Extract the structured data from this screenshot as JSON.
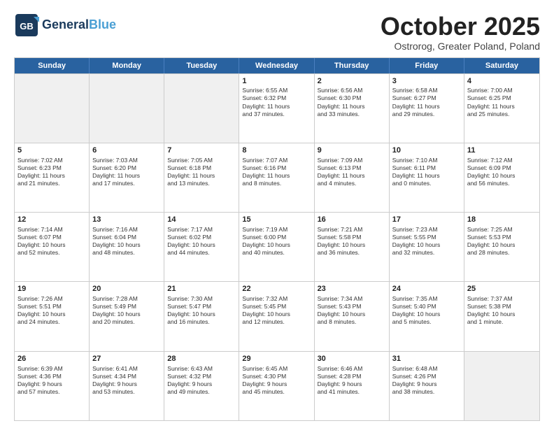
{
  "logo": {
    "line1": "General",
    "line2": "Blue",
    "tagline": ""
  },
  "header": {
    "month": "October 2025",
    "location": "Ostrorog, Greater Poland, Poland"
  },
  "days": [
    "Sunday",
    "Monday",
    "Tuesday",
    "Wednesday",
    "Thursday",
    "Friday",
    "Saturday"
  ],
  "rows": [
    [
      {
        "day": "",
        "content": ""
      },
      {
        "day": "",
        "content": ""
      },
      {
        "day": "",
        "content": ""
      },
      {
        "day": "1",
        "content": "Sunrise: 6:55 AM\nSunset: 6:32 PM\nDaylight: 11 hours\nand 37 minutes."
      },
      {
        "day": "2",
        "content": "Sunrise: 6:56 AM\nSunset: 6:30 PM\nDaylight: 11 hours\nand 33 minutes."
      },
      {
        "day": "3",
        "content": "Sunrise: 6:58 AM\nSunset: 6:27 PM\nDaylight: 11 hours\nand 29 minutes."
      },
      {
        "day": "4",
        "content": "Sunrise: 7:00 AM\nSunset: 6:25 PM\nDaylight: 11 hours\nand 25 minutes."
      }
    ],
    [
      {
        "day": "5",
        "content": "Sunrise: 7:02 AM\nSunset: 6:23 PM\nDaylight: 11 hours\nand 21 minutes."
      },
      {
        "day": "6",
        "content": "Sunrise: 7:03 AM\nSunset: 6:20 PM\nDaylight: 11 hours\nand 17 minutes."
      },
      {
        "day": "7",
        "content": "Sunrise: 7:05 AM\nSunset: 6:18 PM\nDaylight: 11 hours\nand 13 minutes."
      },
      {
        "day": "8",
        "content": "Sunrise: 7:07 AM\nSunset: 6:16 PM\nDaylight: 11 hours\nand 8 minutes."
      },
      {
        "day": "9",
        "content": "Sunrise: 7:09 AM\nSunset: 6:13 PM\nDaylight: 11 hours\nand 4 minutes."
      },
      {
        "day": "10",
        "content": "Sunrise: 7:10 AM\nSunset: 6:11 PM\nDaylight: 11 hours\nand 0 minutes."
      },
      {
        "day": "11",
        "content": "Sunrise: 7:12 AM\nSunset: 6:09 PM\nDaylight: 10 hours\nand 56 minutes."
      }
    ],
    [
      {
        "day": "12",
        "content": "Sunrise: 7:14 AM\nSunset: 6:07 PM\nDaylight: 10 hours\nand 52 minutes."
      },
      {
        "day": "13",
        "content": "Sunrise: 7:16 AM\nSunset: 6:04 PM\nDaylight: 10 hours\nand 48 minutes."
      },
      {
        "day": "14",
        "content": "Sunrise: 7:17 AM\nSunset: 6:02 PM\nDaylight: 10 hours\nand 44 minutes."
      },
      {
        "day": "15",
        "content": "Sunrise: 7:19 AM\nSunset: 6:00 PM\nDaylight: 10 hours\nand 40 minutes."
      },
      {
        "day": "16",
        "content": "Sunrise: 7:21 AM\nSunset: 5:58 PM\nDaylight: 10 hours\nand 36 minutes."
      },
      {
        "day": "17",
        "content": "Sunrise: 7:23 AM\nSunset: 5:55 PM\nDaylight: 10 hours\nand 32 minutes."
      },
      {
        "day": "18",
        "content": "Sunrise: 7:25 AM\nSunset: 5:53 PM\nDaylight: 10 hours\nand 28 minutes."
      }
    ],
    [
      {
        "day": "19",
        "content": "Sunrise: 7:26 AM\nSunset: 5:51 PM\nDaylight: 10 hours\nand 24 minutes."
      },
      {
        "day": "20",
        "content": "Sunrise: 7:28 AM\nSunset: 5:49 PM\nDaylight: 10 hours\nand 20 minutes."
      },
      {
        "day": "21",
        "content": "Sunrise: 7:30 AM\nSunset: 5:47 PM\nDaylight: 10 hours\nand 16 minutes."
      },
      {
        "day": "22",
        "content": "Sunrise: 7:32 AM\nSunset: 5:45 PM\nDaylight: 10 hours\nand 12 minutes."
      },
      {
        "day": "23",
        "content": "Sunrise: 7:34 AM\nSunset: 5:43 PM\nDaylight: 10 hours\nand 8 minutes."
      },
      {
        "day": "24",
        "content": "Sunrise: 7:35 AM\nSunset: 5:40 PM\nDaylight: 10 hours\nand 5 minutes."
      },
      {
        "day": "25",
        "content": "Sunrise: 7:37 AM\nSunset: 5:38 PM\nDaylight: 10 hours\nand 1 minute."
      }
    ],
    [
      {
        "day": "26",
        "content": "Sunrise: 6:39 AM\nSunset: 4:36 PM\nDaylight: 9 hours\nand 57 minutes."
      },
      {
        "day": "27",
        "content": "Sunrise: 6:41 AM\nSunset: 4:34 PM\nDaylight: 9 hours\nand 53 minutes."
      },
      {
        "day": "28",
        "content": "Sunrise: 6:43 AM\nSunset: 4:32 PM\nDaylight: 9 hours\nand 49 minutes."
      },
      {
        "day": "29",
        "content": "Sunrise: 6:45 AM\nSunset: 4:30 PM\nDaylight: 9 hours\nand 45 minutes."
      },
      {
        "day": "30",
        "content": "Sunrise: 6:46 AM\nSunset: 4:28 PM\nDaylight: 9 hours\nand 41 minutes."
      },
      {
        "day": "31",
        "content": "Sunrise: 6:48 AM\nSunset: 4:26 PM\nDaylight: 9 hours\nand 38 minutes."
      },
      {
        "day": "",
        "content": ""
      }
    ]
  ]
}
